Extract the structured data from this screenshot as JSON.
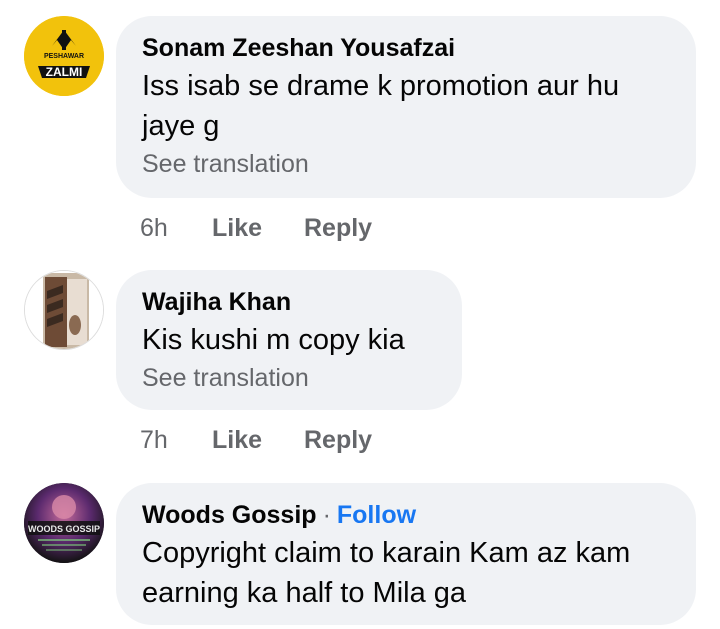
{
  "comments": [
    {
      "author": "Sonam Zeeshan Yousafzai",
      "text": "Iss isab se drame k promotion aur hu jaye g",
      "translation_link": "See translation",
      "time": "6h",
      "like_label": "Like",
      "reply_label": "Reply",
      "avatar": {
        "text_top": "PESHAWAR",
        "text_main": "ZALMI",
        "bg": "#f2c20c",
        "fg": "#0d0d0d"
      }
    },
    {
      "author": "Wajiha Khan",
      "text": "Kis kushi m copy kia",
      "translation_link": "See translation",
      "time": "7h",
      "like_label": "Like",
      "reply_label": "Reply"
    },
    {
      "author": "Woods Gossip",
      "separator": "·",
      "follow_label": "Follow",
      "text": "Copyright claim to karain Kam az kam earning ka half to Mila ga",
      "avatar": {
        "text_main": "WOODS GOSSIP"
      }
    }
  ]
}
